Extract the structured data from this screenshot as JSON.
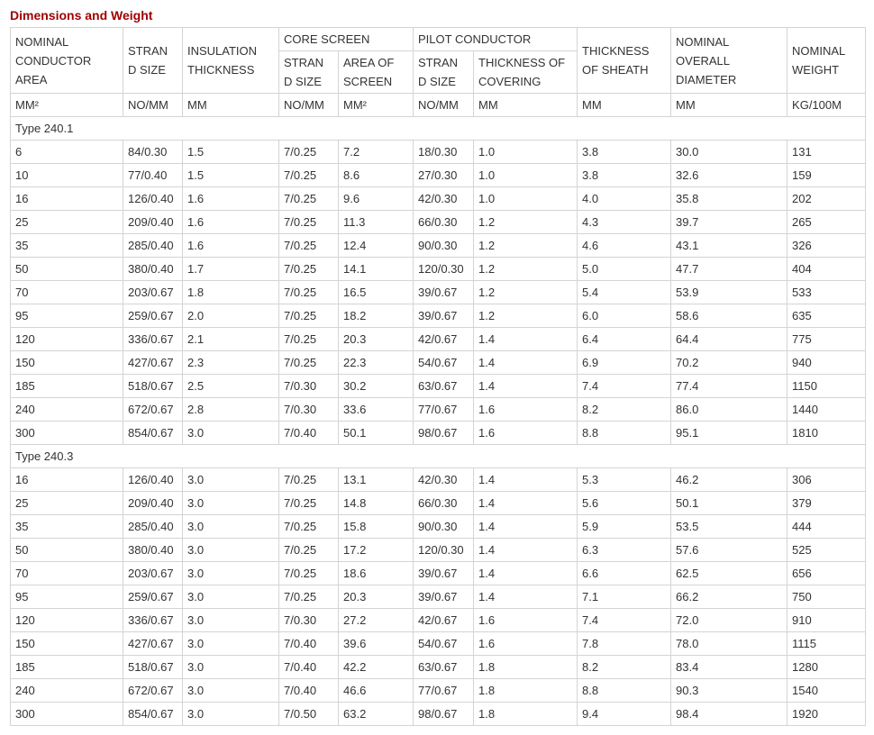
{
  "section": {
    "title": "Dimensions and Weight"
  },
  "headers": {
    "nominal_conductor_area": "NOMINAL CONDUCTOR AREA",
    "strand_size": "STRAN D SIZE",
    "insulation_thickness": "INSULATION THICKNESS",
    "core_screen": "CORE SCREEN",
    "core_strand_size": "STRAN D SIZE",
    "area_of_screen": "AREA OF SCREEN",
    "pilot_conductor": "PILOT CONDUCTOR",
    "pilot_strand_size": "STRAN D SIZE",
    "thickness_of_covering": "THICKNESS OF COVERING",
    "thickness_of_sheath": "THICKNESS OF SHEATH",
    "nominal_overall_diameter": "NOMINAL OVERALL DIAMETER",
    "nominal_weight": "NOMINAL WEIGHT"
  },
  "units": [
    "MM²",
    "NO/MM",
    "MM",
    "NO/MM",
    "MM²",
    "NO/MM",
    "MM",
    "MM",
    "MM",
    "KG/100M"
  ],
  "groups": [
    {
      "label": "Type 240.1",
      "rows": [
        [
          "6",
          "84/0.30",
          "1.5",
          "7/0.25",
          "7.2",
          "18/0.30",
          "1.0",
          "3.8",
          "30.0",
          "131"
        ],
        [
          "10",
          "77/0.40",
          "1.5",
          "7/0.25",
          "8.6",
          "27/0.30",
          "1.0",
          "3.8",
          "32.6",
          "159"
        ],
        [
          "16",
          "126/0.40",
          "1.6",
          "7/0.25",
          "9.6",
          "42/0.30",
          "1.0",
          "4.0",
          "35.8",
          "202"
        ],
        [
          "25",
          "209/0.40",
          "1.6",
          "7/0.25",
          "11.3",
          "66/0.30",
          "1.2",
          "4.3",
          "39.7",
          "265"
        ],
        [
          "35",
          "285/0.40",
          "1.6",
          "7/0.25",
          "12.4",
          "90/0.30",
          "1.2",
          "4.6",
          "43.1",
          "326"
        ],
        [
          "50",
          "380/0.40",
          "1.7",
          "7/0.25",
          "14.1",
          "120/0.30",
          "1.2",
          "5.0",
          "47.7",
          "404"
        ],
        [
          "70",
          "203/0.67",
          "1.8",
          "7/0.25",
          "16.5",
          "39/0.67",
          "1.2",
          "5.4",
          "53.9",
          "533"
        ],
        [
          "95",
          "259/0.67",
          "2.0",
          "7/0.25",
          "18.2",
          "39/0.67",
          "1.2",
          "6.0",
          "58.6",
          "635"
        ],
        [
          "120",
          "336/0.67",
          "2.1",
          "7/0.25",
          "20.3",
          "42/0.67",
          "1.4",
          "6.4",
          "64.4",
          "775"
        ],
        [
          "150",
          "427/0.67",
          "2.3",
          "7/0.25",
          "22.3",
          "54/0.67",
          "1.4",
          "6.9",
          "70.2",
          "940"
        ],
        [
          "185",
          "518/0.67",
          "2.5",
          "7/0.30",
          "30.2",
          "63/0.67",
          "1.4",
          "7.4",
          "77.4",
          "1150"
        ],
        [
          "240",
          "672/0.67",
          "2.8",
          "7/0.30",
          "33.6",
          "77/0.67",
          "1.6",
          "8.2",
          "86.0",
          "1440"
        ],
        [
          "300",
          "854/0.67",
          "3.0",
          "7/0.40",
          "50.1",
          "98/0.67",
          "1.6",
          "8.8",
          "95.1",
          "1810"
        ]
      ]
    },
    {
      "label": "Type 240.3",
      "rows": [
        [
          "16",
          "126/0.40",
          "3.0",
          "7/0.25",
          "13.1",
          "42/0.30",
          "1.4",
          "5.3",
          "46.2",
          "306"
        ],
        [
          "25",
          "209/0.40",
          "3.0",
          "7/0.25",
          "14.8",
          "66/0.30",
          "1.4",
          "5.6",
          "50.1",
          "379"
        ],
        [
          "35",
          "285/0.40",
          "3.0",
          "7/0.25",
          "15.8",
          "90/0.30",
          "1.4",
          "5.9",
          "53.5",
          "444"
        ],
        [
          "50",
          "380/0.40",
          "3.0",
          "7/0.25",
          "17.2",
          "120/0.30",
          "1.4",
          "6.3",
          "57.6",
          "525"
        ],
        [
          "70",
          "203/0.67",
          "3.0",
          "7/0.25",
          "18.6",
          "39/0.67",
          "1.4",
          "6.6",
          "62.5",
          "656"
        ],
        [
          "95",
          "259/0.67",
          "3.0",
          "7/0.25",
          "20.3",
          "39/0.67",
          "1.4",
          "7.1",
          "66.2",
          "750"
        ],
        [
          "120",
          "336/0.67",
          "3.0",
          "7/0.30",
          "27.2",
          "42/0.67",
          "1.6",
          "7.4",
          "72.0",
          "910"
        ],
        [
          "150",
          "427/0.67",
          "3.0",
          "7/0.40",
          "39.6",
          "54/0.67",
          "1.6",
          "7.8",
          "78.0",
          "1115"
        ],
        [
          "185",
          "518/0.67",
          "3.0",
          "7/0.40",
          "42.2",
          "63/0.67",
          "1.8",
          "8.2",
          "83.4",
          "1280"
        ],
        [
          "240",
          "672/0.67",
          "3.0",
          "7/0.40",
          "46.6",
          "77/0.67",
          "1.8",
          "8.8",
          "90.3",
          "1540"
        ],
        [
          "300",
          "854/0.67",
          "3.0",
          "7/0.50",
          "63.2",
          "98/0.67",
          "1.8",
          "9.4",
          "98.4",
          "1920"
        ]
      ]
    }
  ]
}
